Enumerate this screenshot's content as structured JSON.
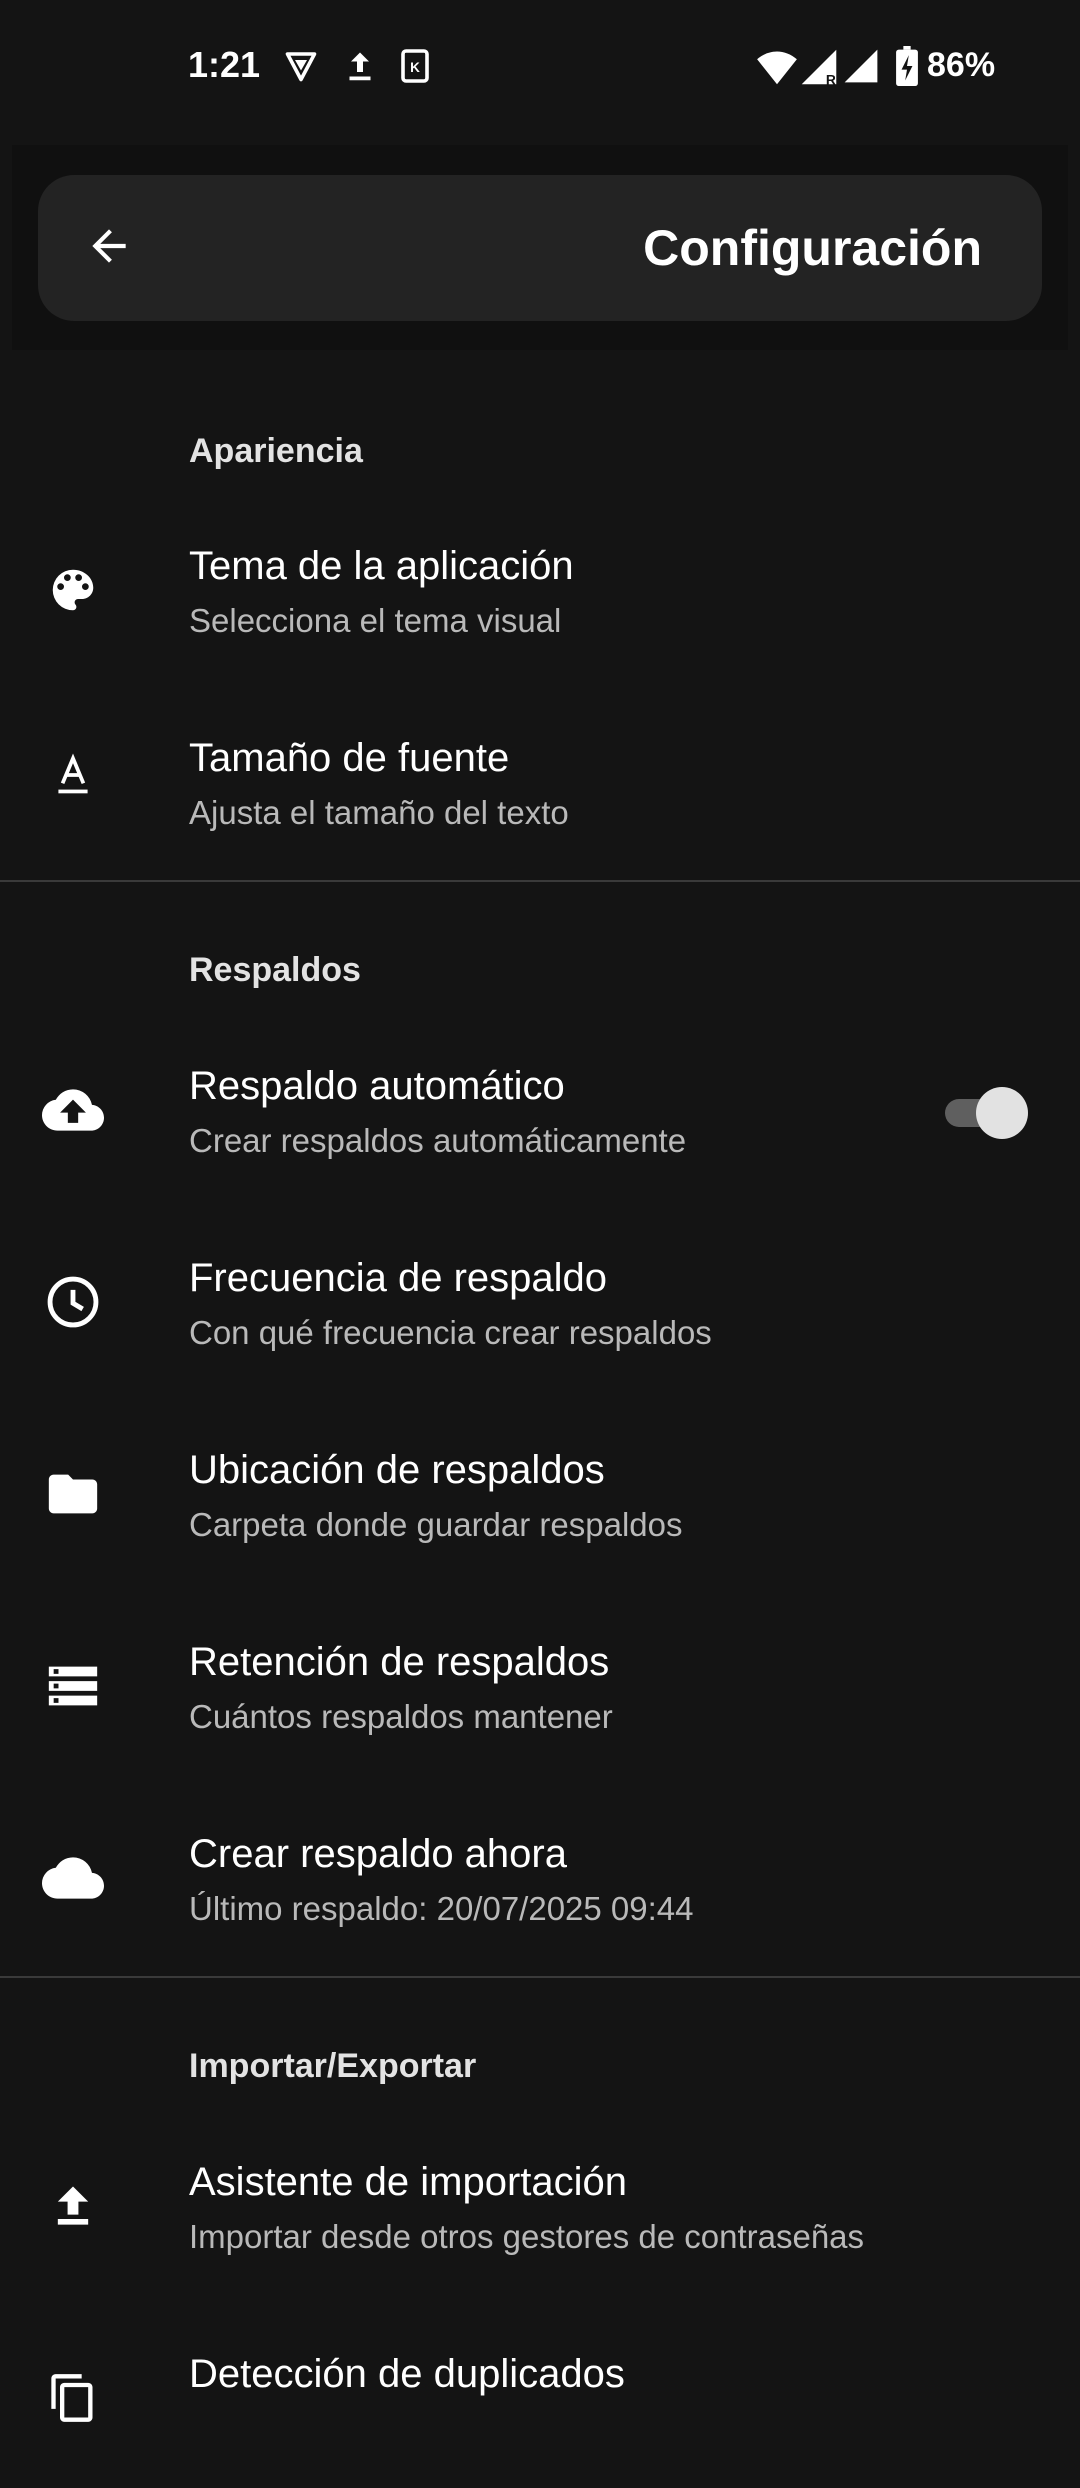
{
  "status_bar": {
    "time": "1:21",
    "battery": "86%",
    "icons": [
      "vpn-icon",
      "upload-icon",
      "sim-icon",
      "wifi-icon",
      "signal-r-icon",
      "signal-icon",
      "battery-icon"
    ]
  },
  "header": {
    "title": "Configuración",
    "back_icon": "arrow-left-icon"
  },
  "sections": [
    {
      "title": "Apariencia",
      "items": [
        {
          "title": "Tema de la aplicación",
          "subtitle": "Selecciona el tema visual",
          "icon": "palette-icon"
        },
        {
          "title": "Tamaño de fuente",
          "subtitle": "Ajusta el tamaño del texto",
          "icon": "font-size-icon"
        }
      ]
    },
    {
      "title": "Respaldos",
      "items": [
        {
          "title": "Respaldo automático",
          "subtitle": "Crear respaldos automáticamente",
          "icon": "cloud-upload-icon",
          "toggle": true
        },
        {
          "title": "Frecuencia de respaldo",
          "subtitle": "Con qué frecuencia crear respaldos",
          "icon": "clock-icon"
        },
        {
          "title": "Ubicación de respaldos",
          "subtitle": "Carpeta donde guardar respaldos",
          "icon": "folder-icon"
        },
        {
          "title": "Retención de respaldos",
          "subtitle": "Cuántos respaldos mantener",
          "icon": "storage-icon"
        },
        {
          "title": "Crear respaldo ahora",
          "subtitle": "Último respaldo: 20/07/2025 09:44",
          "icon": "cloud-icon"
        }
      ]
    },
    {
      "title": "Importar/Exportar",
      "items": [
        {
          "title": "Asistente de importación",
          "subtitle": "Importar desde otros gestores de contraseñas",
          "icon": "import-icon"
        },
        {
          "title": "Detección de duplicados",
          "icon": "duplicate-icon"
        }
      ]
    }
  ],
  "colors": {
    "background": "#141414",
    "app_bar": "#232323",
    "subtitle": "#b9b9b9",
    "divider": "#3a3a3a",
    "toggle_track": "#5f5f5f",
    "toggle_thumb": "#e2e2e2"
  }
}
